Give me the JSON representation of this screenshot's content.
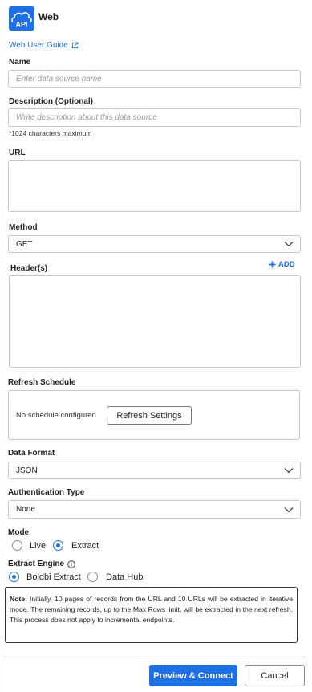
{
  "header": {
    "logo_text": "API",
    "title": "Web"
  },
  "guide": {
    "label": "Web User Guide"
  },
  "name_field": {
    "label": "Name",
    "placeholder": "Enter data source name"
  },
  "description_field": {
    "label": "Description (Optional)",
    "placeholder": "Write description about this data source",
    "hint": "*1024 characters maximum"
  },
  "url_field": {
    "label": "URL"
  },
  "method": {
    "label": "Method",
    "value": "GET"
  },
  "headers": {
    "label": "Header(s)",
    "add_label": "ADD"
  },
  "refresh_schedule": {
    "label": "Refresh Schedule",
    "status": "No schedule configured",
    "button": "Refresh Settings"
  },
  "data_format": {
    "label": "Data Format",
    "value": "JSON"
  },
  "auth_type": {
    "label": "Authentication Type",
    "value": "None"
  },
  "mode": {
    "label": "Mode",
    "options": [
      "Live",
      "Extract"
    ],
    "selected": "Extract"
  },
  "extract_engine": {
    "label": "Extract Engine",
    "options": [
      "Boldbi Extract",
      "Data Hub"
    ],
    "selected": "Boldbi Extract"
  },
  "note": {
    "prefix": "Note:",
    "text": " Initially, 10 pages of records from the URL and 10 URLs will be extracted in iterative mode. The remaining records, up to the Max Rows limit, will be extracted in the next refresh. This process does not apply to incremental endpoints."
  },
  "footer": {
    "primary": "Preview & Connect",
    "cancel": "Cancel"
  },
  "colors": {
    "accent": "#1f6fe5",
    "link": "#1f6fcf",
    "border": "#c7c7c7"
  }
}
